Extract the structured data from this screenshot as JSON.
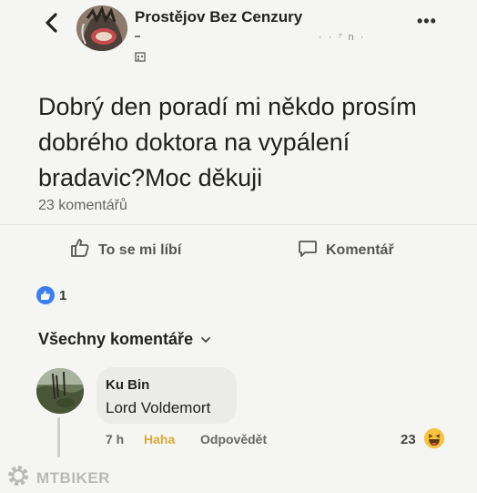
{
  "header": {
    "group_name": "Prostějov Bez Cenzury",
    "meta": "· · ⁷ n ·"
  },
  "post": {
    "text": "Dobrý den poradí mi někdo prosím dobrého doktora na vypálení bradavic?Moc děkuji",
    "comment_count": "23 komentářů"
  },
  "actions": {
    "like_label": "To se mi líbí",
    "comment_label": "Komentář"
  },
  "reactions": {
    "count": "1"
  },
  "comments_section": {
    "filter_label": "Všechny komentáře"
  },
  "comment": {
    "author": "Ku Bin",
    "text": "Lord Voldemort",
    "time": "7 h",
    "react_label": "Haha",
    "reply_label": "Odpovědět",
    "reaction_count": "23"
  },
  "watermark": {
    "text": "MTBIKER"
  },
  "colors": {
    "like_blue": "#3b7ef0",
    "haha_yellow": "#f7c23d",
    "haha_text": "#d8a93a"
  }
}
